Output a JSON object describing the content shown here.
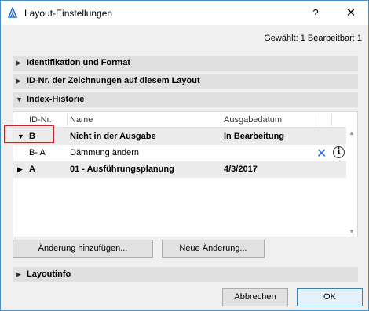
{
  "window": {
    "title": "Layout-Einstellungen",
    "help": "?",
    "close": "✕"
  },
  "selection_info": "Gewählt: 1 Bearbeitbar: 1",
  "sections": {
    "ident": "Identifikation und Format",
    "idnr": "ID-Nr. der Zeichnungen auf diesem Layout",
    "history": "Index-Historie",
    "layoutinfo": "Layoutinfo"
  },
  "table": {
    "headers": [
      "ID-Nr.",
      "Name",
      "Ausgabedatum"
    ],
    "rows": [
      {
        "id": "B",
        "name": "Nicht in der Ausgabe",
        "date": "In Bearbeitung"
      },
      {
        "id": "B- A",
        "name": "Dämmung ändern",
        "date": ""
      },
      {
        "id": "A",
        "name": "01 - Ausführungsplanung",
        "date": "4/3/2017"
      }
    ]
  },
  "buttons": {
    "add_change": "Änderung hinzufügen...",
    "new_change": "Neue Änderung...",
    "cancel": "Abbrechen",
    "ok": "OK"
  },
  "icons": {
    "delete": "close-x-icon",
    "info": "info-icon",
    "accent": "#2b6fd6",
    "highlight": "#c0242b"
  }
}
